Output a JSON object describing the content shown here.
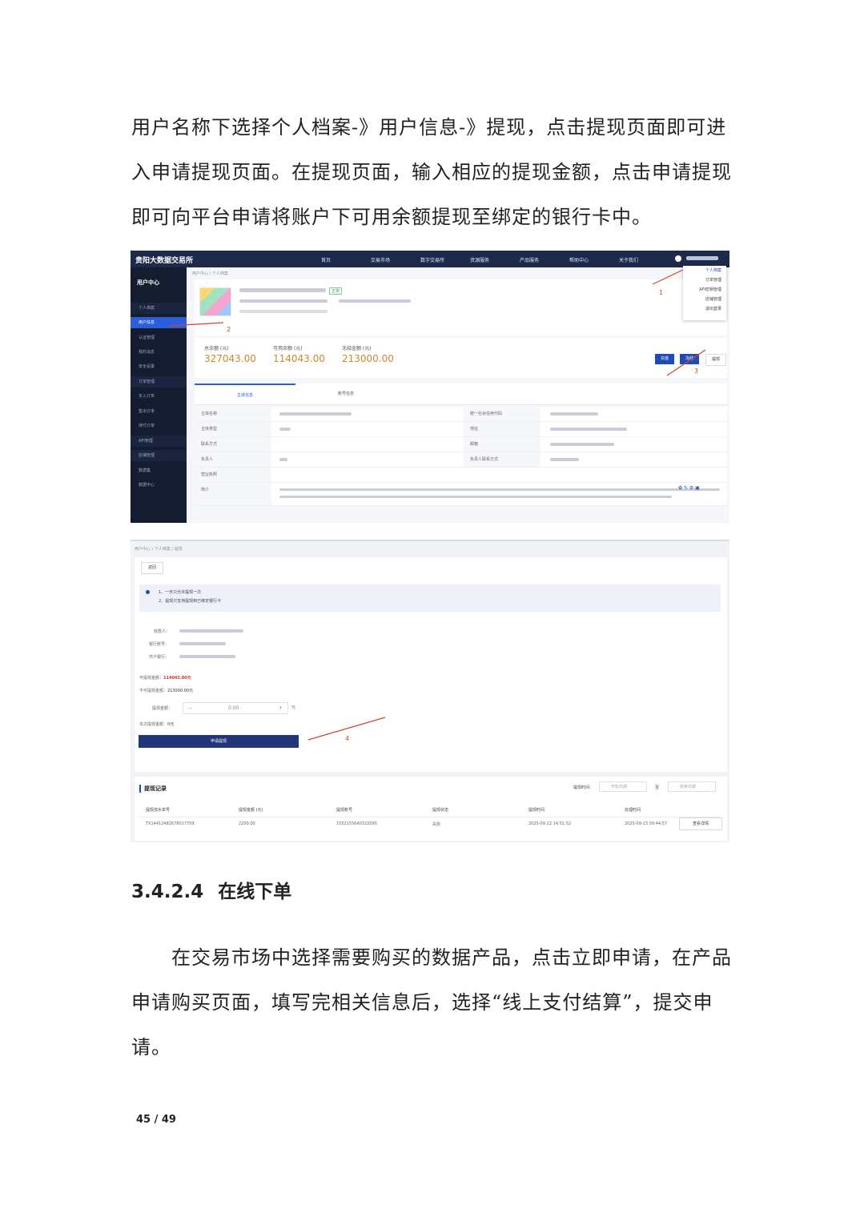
{
  "paragraphs": {
    "intro": "用户名称下选择个人档案-》用户信息-》提现，点击提现页面即可进入申请提现页面。在提现页面，输入相应的提现金额，点击申请提现即可向平台申请将账户下可用余额提现至绑定的银行卡中。",
    "order": "在交易市场中选择需要购买的数据产品，点击立即申请，在产品申请购买页面，填写完相关信息后，选择“线上支付结算”，提交申请。"
  },
  "section_heading": {
    "number": "3.4.2.4",
    "title": "在线下单"
  },
  "page_number": "45 / 49",
  "screenshot1": {
    "logo": "贵阳大数据交易所",
    "nav": [
      "首页",
      "交易市场",
      "数字交易所",
      "资源服务",
      "产品服务",
      "帮助中心",
      "关于我们"
    ],
    "sidebar_title": "用户中心",
    "sidebar_items": [
      {
        "label": "个人档案",
        "group": true
      },
      {
        "label": "用户信息",
        "active": true
      },
      {
        "label": "认证管理"
      },
      {
        "label": "我的消息"
      },
      {
        "label": "安全设置"
      },
      {
        "label": "订单管理",
        "group": true
      },
      {
        "label": "买入订单"
      },
      {
        "label": "售出订单"
      },
      {
        "label": "待付订单"
      },
      {
        "label": "API管理",
        "group": true
      },
      {
        "label": "店铺管理",
        "group": true
      },
      {
        "label": "数据集"
      },
      {
        "label": "数据中心"
      }
    ],
    "breadcrumb": "用户中心 / 个人档案",
    "tag": "正常",
    "stats": [
      {
        "label": "总余额 (元)",
        "value": "327043.00"
      },
      {
        "label": "可用余额 (元)",
        "value": "114043.00"
      },
      {
        "label": "冻结金额 (元)",
        "value": "213000.00"
      }
    ],
    "buttons": [
      "充值",
      "冻结",
      "提现"
    ],
    "tabs": [
      "主体信息",
      "账号信息"
    ],
    "table_labels_left": [
      "主体名称",
      "主体类型",
      "联系方式",
      "负责人",
      "营业执照",
      "简介"
    ],
    "table_labels_right": [
      "统一社会信用代码",
      "地址",
      "邮箱",
      "负责人联系方式"
    ],
    "dropdown": [
      "个人档案",
      "订单管理",
      "API密钥管理",
      "店铺管理",
      "退出登录"
    ],
    "annotations": [
      "1",
      "2",
      "3"
    ]
  },
  "screenshot2": {
    "breadcrumb": "用户中心 / 个人档案 / 提现",
    "back": "返回",
    "notice": [
      "1、一天只允许提现一次",
      "2、提现只支持提现到已绑定银行卡"
    ],
    "payee_label": "收款人：",
    "bank_no_label": "银行账号：",
    "bank_label": "开户银行：",
    "available_label": "可提现金额：",
    "available_value": "114043.00元",
    "frozen_label": "不可提现金额：",
    "frozen_value": "213000.00元",
    "amount_label": "提现金额：",
    "amount_value": "0.00",
    "amount_unit": "元",
    "minus": "−",
    "plus": "+",
    "after_label": "本次提现金额：",
    "after_value": "0元",
    "submit": "申请提现",
    "annotation": "4",
    "record_title": "提现记录",
    "filter_label": "提现时间：",
    "start_placeholder": "开始日期",
    "to": "至",
    "end_placeholder": "结束日期",
    "columns": [
      "提现流水单号",
      "提现金额 (元)",
      "提现账号",
      "提现状态",
      "提现时间",
      "处理时间"
    ],
    "row": [
      "TX14412482678017709",
      "2200.00",
      "1552155640322095",
      "失败",
      "2025-09-22 14:51:52",
      "2025-09-23 09:44:57"
    ],
    "detail_btn": "查看详情"
  }
}
